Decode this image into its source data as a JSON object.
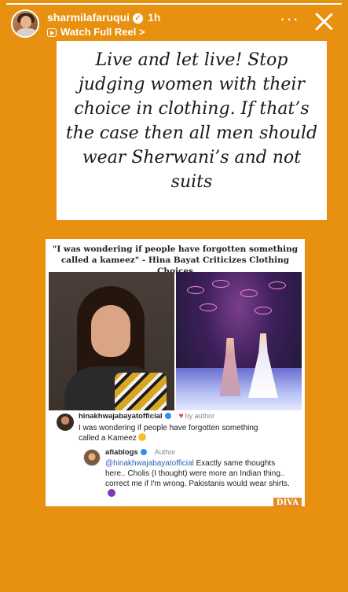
{
  "story": {
    "progress": 1.0
  },
  "header": {
    "username": "sharmilafaruqui",
    "verified_mark": "✓",
    "time": "1h",
    "watch_reel": "Watch Full Reel >",
    "more": "···"
  },
  "quote": {
    "text": "Live and let live! Stop judging women with their choice in clothing. If that’s the case then all men should wear Sherwani’s and not suits"
  },
  "article": {
    "headline": "\"I was wondering if people have forgotten something called a kameez\" - Hina Bayat Criticizes Clothing Choices",
    "comment1": {
      "username": "hinakhwajabayatofficial",
      "heart_label": "by author",
      "text": "I was wondering if people have forgotten something called a Kameez"
    },
    "comment2": {
      "username": "afiablogs",
      "author_label": "Author",
      "mention": "@hinakhwajabayatofficial",
      "text": "Exactly same thoughts here.. Cholis (I thought) were more an Indian thing.. correct me if I'm wrong. Pakistanis would wear shirts."
    },
    "watermark": "DIVA"
  },
  "colors": {
    "background": "#e8900f",
    "link": "#2b5fb8",
    "verified": "#2f8ff0"
  },
  "icons": [
    "avatar",
    "verified-icon",
    "reel-icon",
    "more-icon",
    "close-icon",
    "heart-icon"
  ]
}
